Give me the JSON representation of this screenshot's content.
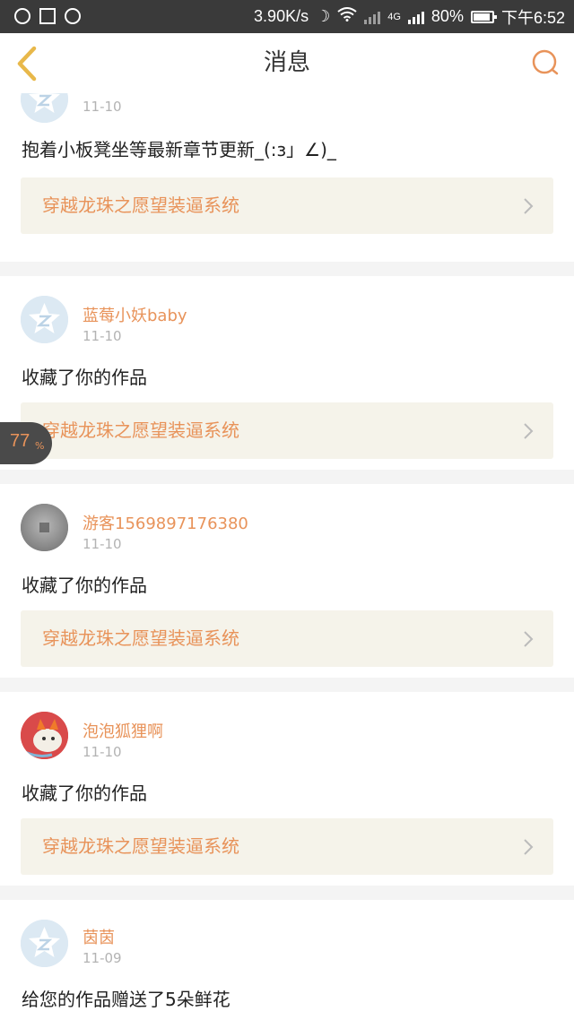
{
  "status_bar": {
    "net_speed": "3.90K/s",
    "network_type": "4G",
    "battery": "80%",
    "battery_level": 0.8,
    "time": "下午6:52"
  },
  "header": {
    "title": "消息",
    "back_icon": "chevron-left-icon",
    "search_icon": "search-icon"
  },
  "colors": {
    "accent": "#e8935a",
    "book_bg": "#f5f3ea",
    "divider": "#f4f4f4"
  },
  "messages": [
    {
      "user": "，",
      "time": "11-10",
      "content": "抱着小板凳坐等最新章节更新_(:з」∠)_",
      "book": "穿越龙珠之愿望装逼系统",
      "avatar": "default-avatar-icon"
    },
    {
      "user": "蓝莓小妖baby",
      "time": "11-10",
      "content": "收藏了你的作品",
      "book": "穿越龙珠之愿望装逼系统",
      "avatar": "default-avatar-icon"
    },
    {
      "user": "游客1569897176380",
      "time": "11-10",
      "content": "收藏了你的作品",
      "book": "穿越龙珠之愿望装逼系统",
      "avatar": "guest-avatar-icon"
    },
    {
      "user": "泡泡狐狸啊",
      "time": "11-10",
      "content": "收藏了你的作品",
      "book": "穿越龙珠之愿望装逼系统",
      "avatar": "fox-avatar-icon"
    },
    {
      "user": "茵茵",
      "time": "11-09",
      "content": "给您的作品赠送了5朵鲜花",
      "book": "",
      "avatar": "default-avatar-icon"
    }
  ],
  "floating_bubble": {
    "value": "77",
    "unit": "%"
  }
}
